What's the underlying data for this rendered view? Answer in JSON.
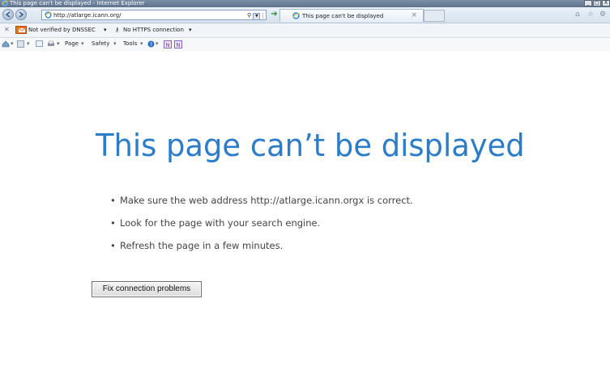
{
  "window": {
    "title": "This page can't be displayed - Internet Explorer",
    "buttons": [
      "_",
      "□",
      "X"
    ]
  },
  "navigation": {
    "address": "http://atlarge.icann.org/",
    "tab_title": "This page can't be displayed"
  },
  "security_bar": {
    "dnssec_label": "Not verified by DNSSEC",
    "https_label": "No HTTPS connection"
  },
  "command_bar": {
    "page_label": "Page",
    "safety_label": "Safety",
    "tools_label": "Tools"
  },
  "main": {
    "heading": "This page can’t be displayed",
    "tips": [
      "Make sure the web address http://atlarge.icann.orgx is correct.",
      "Look for the page with your search engine.",
      "Refresh the page in a few minutes."
    ],
    "fix_button_label": "Fix connection problems"
  },
  "colors": {
    "heading": "#2c7cc8",
    "text": "#444444",
    "dnssec_icon": "#e8732a"
  },
  "icons": [
    "ie-logo-icon",
    "back-icon",
    "forward-icon",
    "search-icon",
    "refresh-icon",
    "go-icon",
    "home-icon",
    "favorites-icon",
    "gear-icon",
    "help-icon",
    "onenote-icon"
  ]
}
